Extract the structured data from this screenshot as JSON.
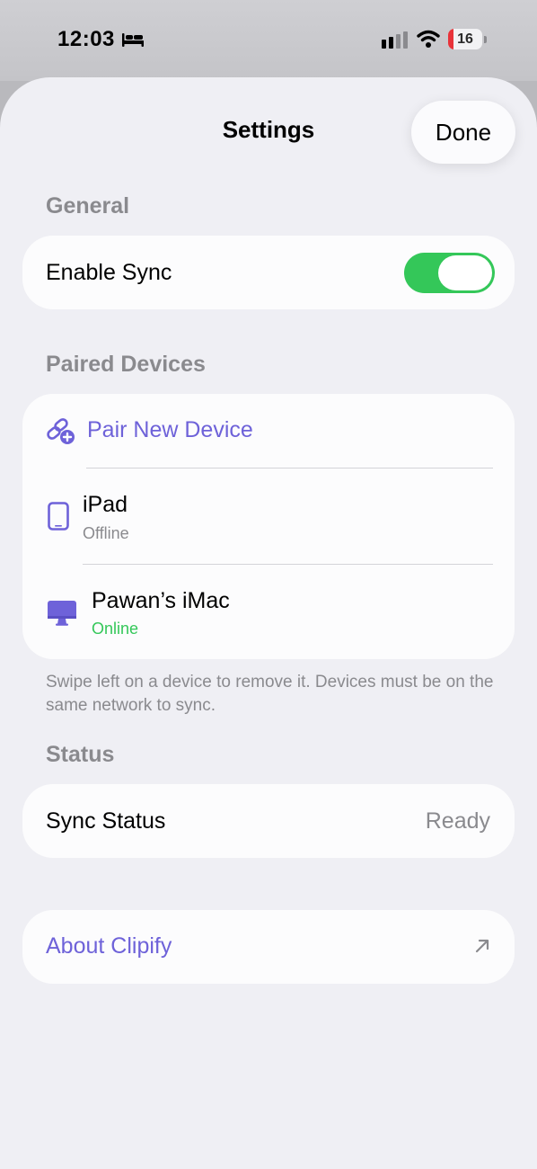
{
  "status_bar": {
    "time": "12:03",
    "battery_level": "16",
    "battery_fraction": 0.16,
    "icons": [
      "bed-icon",
      "cellular-signal-icon",
      "wifi-icon",
      "battery-icon"
    ]
  },
  "nav": {
    "title": "Settings",
    "done_label": "Done"
  },
  "general": {
    "header": "General",
    "enable_sync": {
      "label": "Enable Sync",
      "on": true
    }
  },
  "paired_devices": {
    "header": "Paired Devices",
    "pair_new_label": "Pair New Device",
    "devices": [
      {
        "name": "iPad",
        "status": "Offline",
        "icon": "ipad-icon"
      },
      {
        "name": "Pawan’s iMac",
        "status": "Online",
        "icon": "imac-icon"
      }
    ],
    "footnote": "Swipe left on a device to remove it. Devices must be on the same network to sync."
  },
  "status_section": {
    "header": "Status",
    "sync_status_label": "Sync Status",
    "sync_status_value": "Ready"
  },
  "about": {
    "label": "About Clipify"
  },
  "colors": {
    "accent": "#6e62d9",
    "toggle_on": "#34c759",
    "online": "#34c759",
    "secondary_text": "#8a8a8e",
    "battery_low": "#e8333a"
  }
}
